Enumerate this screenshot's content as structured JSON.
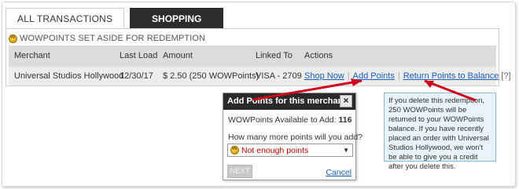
{
  "tabs": {
    "all": "ALL TRANSACTIONS",
    "shopping": "SHOPPING HISTORY"
  },
  "section_title": "WOWPOINTS SET ASIDE FOR REDEMPTION",
  "table": {
    "headers": [
      "Merchant",
      "Last Load",
      "Amount",
      "Linked To",
      "Actions"
    ],
    "row": {
      "merchant": "Universal Studios Hollywood",
      "last_load": "12/30/17",
      "amount": "$ 2.50 (250 WOWPoints)",
      "linked_to": "VISA - 2709",
      "shop_now": "Shop Now",
      "add_points": "Add Points",
      "return_points": "Return Points to Balance",
      "help": "[?]"
    }
  },
  "popup": {
    "title": "Add Points for this merchant",
    "close": "×",
    "available_label": "WOWPoints Available to Add:",
    "available_value": "116",
    "question": "How many more points will you add?",
    "select_value": "Not enough points",
    "next": "NEXT",
    "cancel": "Cancel"
  },
  "tooltip": "If you delete this redemption, 250 WOWPoints will be returned to your WOWPoints balance. If you have recently placed an order with Universal Studios Hollywood, we won't be able to give you a credit after you delete this.",
  "colors": {
    "link": "#1a5db8",
    "arrow": "#d0021b",
    "error": "#c00000",
    "dark": "#2d2d2d"
  }
}
